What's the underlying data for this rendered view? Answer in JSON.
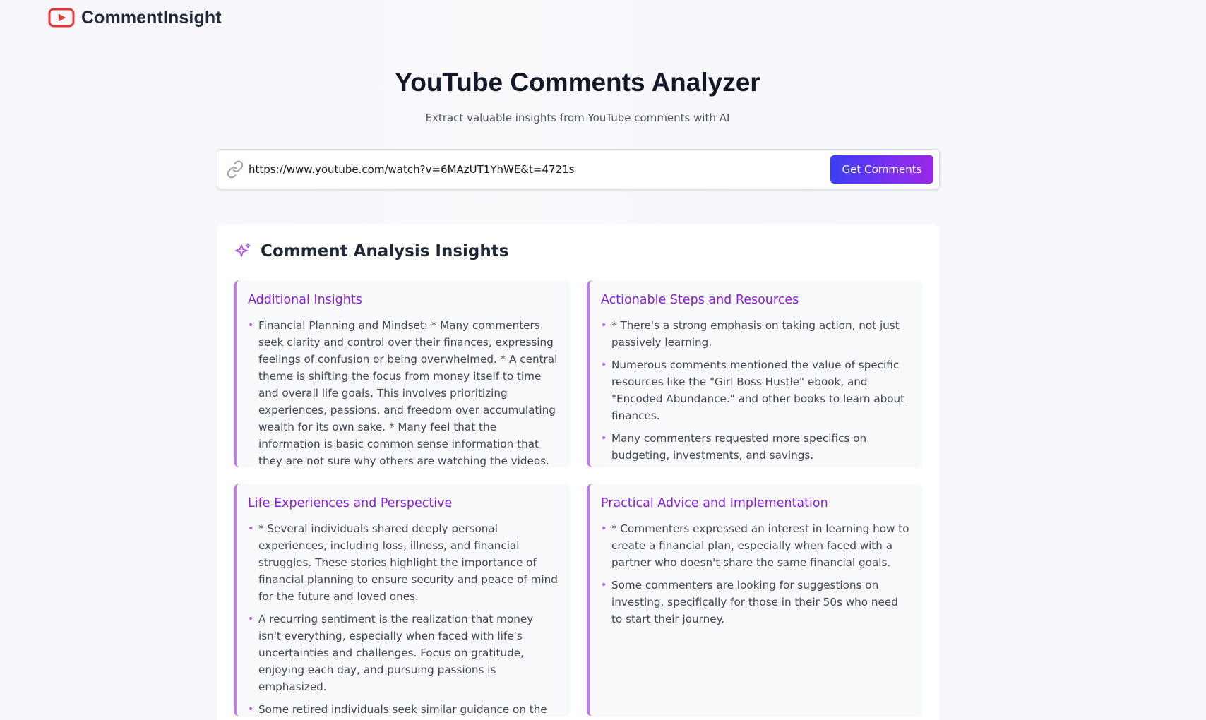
{
  "app": {
    "brand": "CommentInsight",
    "logo_icon": "youtube-play-icon",
    "accent": "#e53935"
  },
  "hero": {
    "title": "YouTube Comments Analyzer",
    "subtitle": "Extract valuable insights from YouTube comments with AI"
  },
  "search": {
    "icon": "link-icon",
    "url_value": "https://www.youtube.com/watch?v=6MAzUT1YhWE&t=4721s",
    "button_label": "Get Comments",
    "button_gradient": [
      "#3b3ff2",
      "#9b28e8"
    ]
  },
  "insights": {
    "icon": "sparkles-icon",
    "title": "Comment Analysis Insights",
    "cards": [
      {
        "title": "Additional Insights",
        "items": [
          "Financial Planning and Mindset: * Many commenters seek clarity and control over their finances, expressing feelings of confusion or being overwhelmed. * A central theme is shifting the focus from money itself to time and overall life goals. This involves prioritizing experiences, passions, and freedom over accumulating wealth for its own sake. * Many feel that the information is basic common sense information that they are not sure why others are watching the videos."
        ]
      },
      {
        "title": "Actionable Steps and Resources",
        "items": [
          "* There's a strong emphasis on taking action, not just passively learning.",
          "Numerous comments mentioned the value of specific resources like the \"Girl Boss Hustle\" ebook, and \"Encoded Abundance.\" and other books to learn about finances.",
          "Many commenters requested more specifics on budgeting, investments, and savings."
        ]
      },
      {
        "title": "Life Experiences and Perspective",
        "items": [
          "* Several individuals shared deeply personal experiences, including loss, illness, and financial struggles. These stories highlight the importance of financial planning to ensure security and peace of mind for the future and loved ones.",
          "A recurring sentiment is the realization that money isn't everything, especially when faced with life's uncertainties and challenges. Focus on gratitude, enjoying each day, and pursuing passions is emphasized.",
          "Some retired individuals seek similar guidance on the financial planning process."
        ]
      },
      {
        "title": "Practical Advice and Implementation",
        "items": [
          "* Commenters expressed an interest in learning how to create a financial plan, especially when faced with a partner who doesn't share the same financial goals.",
          "Some commenters are looking for suggestions on investing, specifically for those in their 50s who need to start their journey."
        ]
      }
    ]
  }
}
